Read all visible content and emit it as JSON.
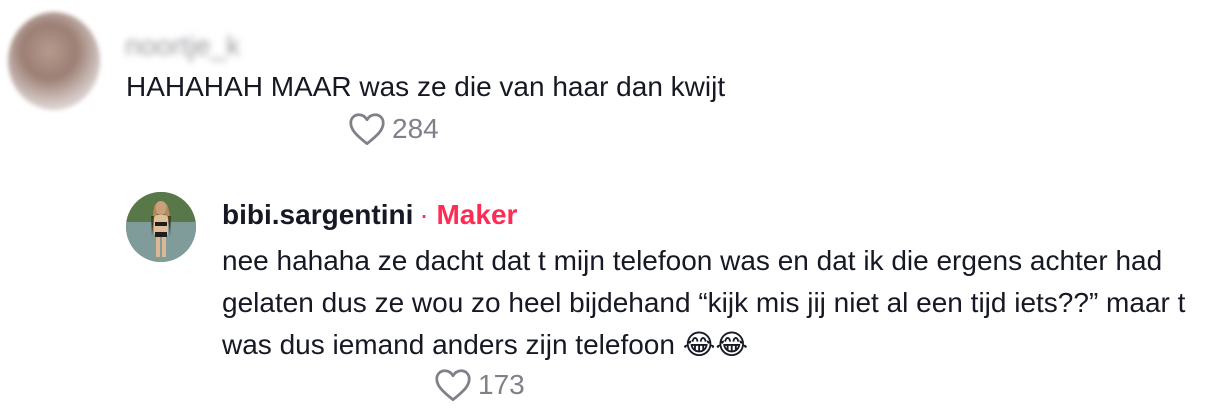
{
  "comments": [
    {
      "username": "noortje_k",
      "text": "HAHAHAH MAAR was ze die van haar dan kwijt",
      "likes": "284"
    }
  ],
  "reply": {
    "username": "bibi.sargentini",
    "separator": "·",
    "badge": "Maker",
    "text": "nee hahaha ze dacht dat t mijn telefoon was en dat ik die ergens achter had gelaten dus ze wou zo heel bijdehand “kijk mis jij niet al een tijd iets??” maar t was dus iemand anders zijn telefoon 😂😂",
    "likes": "173"
  },
  "colors": {
    "maker_badge": "#fe2c55",
    "text": "#161823",
    "secondary": "#80808a"
  },
  "icons": {
    "like": "heart-outline-icon"
  }
}
